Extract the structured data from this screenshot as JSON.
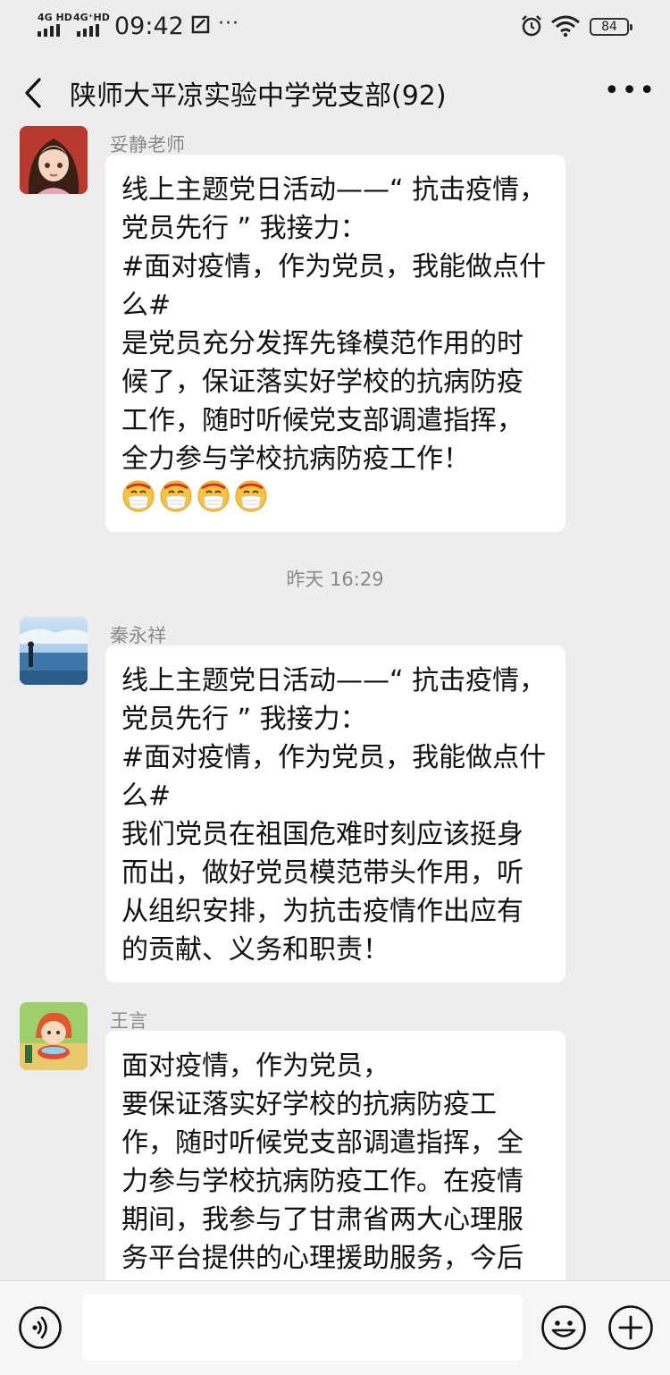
{
  "status_bar": {
    "sim1_label": "4G HD",
    "sim2_label": "4G⁺HD",
    "time": "09:42",
    "battery": "84"
  },
  "header": {
    "title": "陕师大平凉实验中学党支部(92)"
  },
  "messages": [
    {
      "sender": "妥静老师",
      "text": "线上主题党日活动——“ 抗击疫情，党员先行 ” 我接力：\n#面对疫情，作为党员，我能做点什么#\n是党员充分发挥先锋模范作用的时候了，保证落实好学校的抗病防疫工作，随时听候党支部调遣指挥，全力参与学校抗病防疫工作！",
      "emoji_count": 4
    },
    {
      "timestamp": "昨天 16:29"
    },
    {
      "sender": "秦永祥",
      "text": "线上主题党日活动——“ 抗击疫情，党员先行 ” 我接力：\n#面对疫情，作为党员，我能做点什么#\n我们党员在祖国危难时刻应该挺身而出，做好党员模范带头作用，听从组织安排，为抗击疫情作出应有的贡献、义务和职责！"
    },
    {
      "sender": "王言",
      "text": "面对疫情，作为党员，\n要保证落实好学校的抗病防疫工作，随时听候党支部调遣指挥，全力参与学校抗病防疫工作。在疫情期间，我参与了甘肃省两大心理服务平台提供的心理援助服务，今后我将继"
    }
  ],
  "colors": {
    "background": "#ededed",
    "bubble": "#ffffff",
    "meta_text": "#8a8a8a"
  },
  "icons": [
    "signal-icon",
    "screenshot-icon",
    "alarm-icon",
    "wifi-icon",
    "battery-icon",
    "back-arrow-icon",
    "more-icon",
    "voice-icon",
    "emoji-face-icon",
    "plus-icon"
  ]
}
